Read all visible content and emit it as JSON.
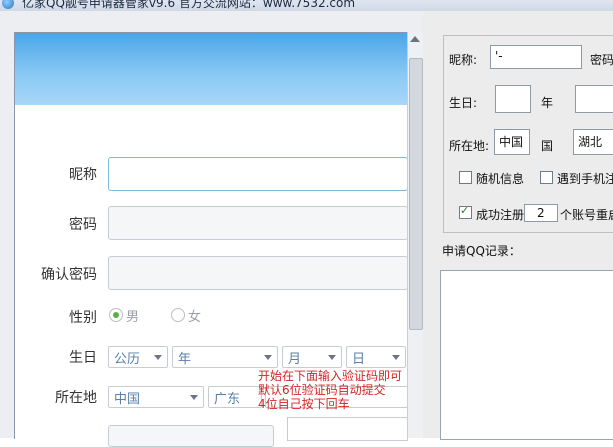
{
  "window": {
    "title": "亿家QQ靓号申请器管家v9.6 官方交流网站：www.7532.com"
  },
  "form": {
    "nickname_label": "昵称",
    "password_label": "密码",
    "confirm_label": "确认密码",
    "gender_label": "性别",
    "gender_male": "男",
    "gender_female": "女",
    "birthday_label": "生日",
    "birthday_calendar": "公历",
    "birthday_year": "年",
    "birthday_month": "月",
    "birthday_day": "日",
    "location_label": "所在地",
    "location_country": "中国",
    "location_province": "广东",
    "tip_lines": [
      "开始在下面输入验证码即可",
      "默认6位验证码自动提交",
      "4位自己按下回车"
    ]
  },
  "settings": {
    "nickname_label": "昵称:",
    "nickname_value": "'-",
    "password_label": "密码",
    "birthday_label": "生日:",
    "year_label": "年",
    "location_label": "所在地:",
    "country_value": "中国",
    "country_label": "国",
    "province_value": "湖北",
    "random_info_label": "随机信息",
    "random_info_checked": false,
    "phone_label": "遇到手机注",
    "phone_checked": false,
    "success_label": "成功注册",
    "success_checked": true,
    "success_count": "2",
    "reset_label": "个账号重启"
  },
  "records": {
    "label": "申请QQ记录："
  }
}
